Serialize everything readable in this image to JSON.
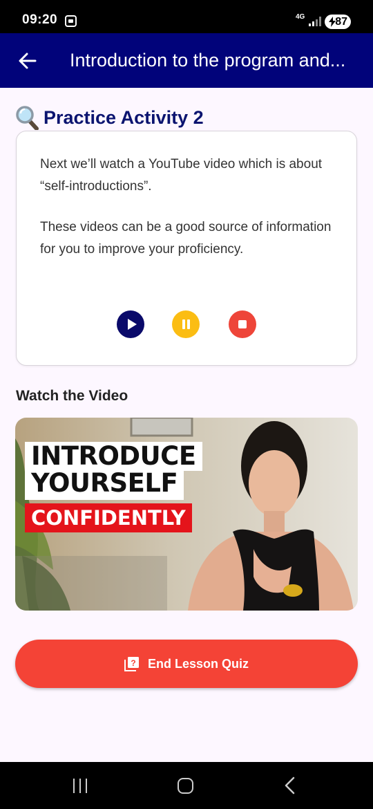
{
  "status_bar": {
    "time": "09:20",
    "network": "4G",
    "battery": "87",
    "icons": [
      "screenshot-icon",
      "signal-icon",
      "battery-charging-icon"
    ]
  },
  "app_bar": {
    "title": "Introduction to the program and...",
    "back_icon": "arrow-left-icon",
    "background_color": "#01037a"
  },
  "activity": {
    "title": "Practice Activity 2",
    "icon": "magnifier-icon",
    "paragraphs": [
      "Next we’ll watch a YouTube video which is about “self-introductions”.",
      "These videos can be a good source of information for you to improve your proficiency."
    ],
    "controls": [
      {
        "name": "play",
        "color": "#0a0a6a"
      },
      {
        "name": "pause",
        "color": "#fbbd13"
      },
      {
        "name": "stop",
        "color": "#ee4539"
      }
    ]
  },
  "video": {
    "heading": "Watch the Video",
    "thumbnail_text": [
      "INTRODUCE",
      "YOURSELF",
      "CONFIDENTLY"
    ]
  },
  "quiz_button": {
    "label": "End Lesson Quiz",
    "icon": "quiz-icon",
    "color": "#f44336"
  },
  "nav_bar": {
    "icons": [
      "recent-apps-icon",
      "home-icon",
      "back-icon"
    ]
  }
}
